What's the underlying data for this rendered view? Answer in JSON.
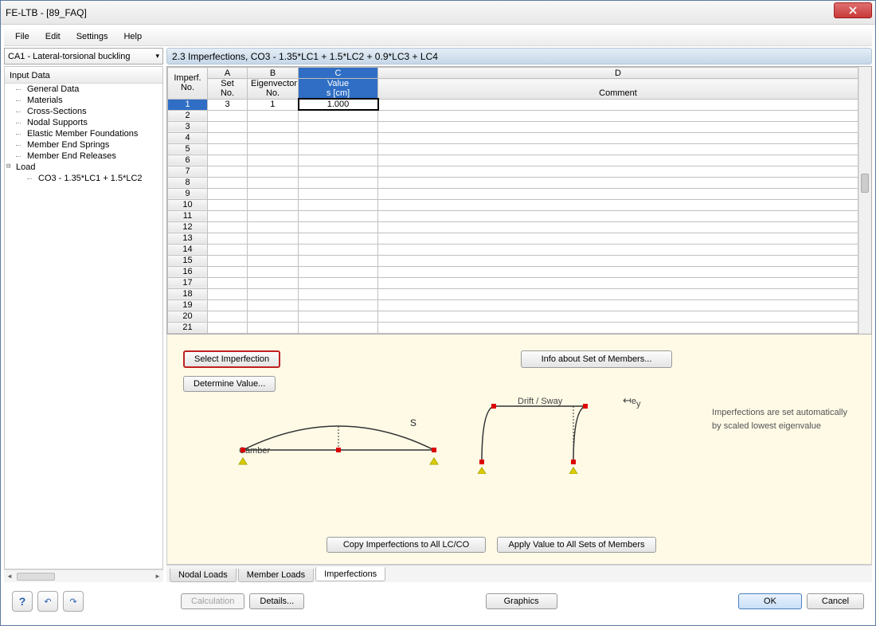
{
  "window": {
    "title": "FE-LTB - [89_FAQ]"
  },
  "menu": {
    "file": "File",
    "edit": "Edit",
    "settings": "Settings",
    "help": "Help"
  },
  "combo": {
    "selected": "CA1 - Lateral-torsional buckling"
  },
  "tree": {
    "header": "Input Data",
    "items": [
      "General Data",
      "Materials",
      "Cross-Sections",
      "Nodal Supports",
      "Elastic Member Foundations",
      "Member End Springs",
      "Member End Releases"
    ],
    "load_label": "Load",
    "load_sub": "CO3 - 1.35*LC1 + 1.5*LC2"
  },
  "panel": {
    "title": "2.3 Imperfections, CO3 - 1.35*LC1 + 1.5*LC2 + 0.9*LC3 + LC4"
  },
  "grid": {
    "cols": {
      "A": "A",
      "B": "B",
      "C": "C",
      "D": "D"
    },
    "hdr": {
      "imperf": "Imperf.",
      "no": "No.",
      "set": "Set",
      "setno": "No.",
      "eigv": "Eigenvector",
      "eigvno": "No.",
      "value": "Value",
      "scm": "s [cm]",
      "comment": "Comment"
    },
    "rows": 21,
    "row1": {
      "set": "3",
      "eigv": "1",
      "value": "1.000",
      "comment": ""
    }
  },
  "lower": {
    "select_imperf": "Select Imperfection",
    "determine_value": "Determine Value...",
    "info_set": "Info about Set of Members...",
    "copy": "Copy Imperfections to All LC/CO",
    "apply": "Apply Value to All Sets of Members",
    "camber": "Camber",
    "s": "s",
    "drift": "Drift / Sway",
    "ey": "e",
    "ey_sub": "y",
    "info_text1": "Imperfections are set automatically",
    "info_text2": "by scaled lowest eigenvalue"
  },
  "tabs": {
    "nodal": "Nodal Loads",
    "member": "Member Loads",
    "imperf": "Imperfections"
  },
  "footer": {
    "calc": "Calculation",
    "details": "Details...",
    "graphics": "Graphics",
    "ok": "OK",
    "cancel": "Cancel"
  }
}
